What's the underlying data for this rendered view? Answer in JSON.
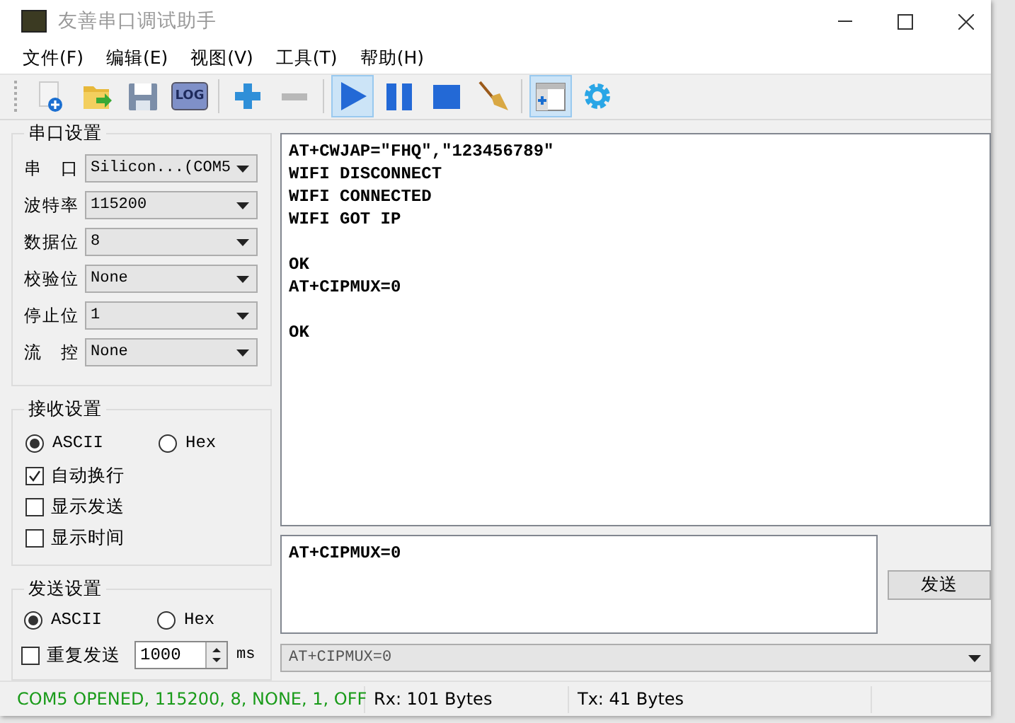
{
  "window": {
    "title": "友善串口调试助手"
  },
  "menu": [
    "文件(F)",
    "编辑(E)",
    "视图(V)",
    "工具(T)",
    "帮助(H)"
  ],
  "toolbar": [
    {
      "kind": "new",
      "selected": false
    },
    {
      "kind": "open",
      "selected": false
    },
    {
      "kind": "save",
      "selected": false
    },
    {
      "kind": "log",
      "label": "LOG",
      "selected": false
    },
    {
      "kind": "sep"
    },
    {
      "kind": "add",
      "selected": false
    },
    {
      "kind": "remove",
      "selected": false
    },
    {
      "kind": "sep"
    },
    {
      "kind": "play",
      "selected": true
    },
    {
      "kind": "pause",
      "selected": false
    },
    {
      "kind": "stop",
      "selected": false
    },
    {
      "kind": "clear",
      "selected": false
    },
    {
      "kind": "sep"
    },
    {
      "kind": "window",
      "selected": true
    },
    {
      "kind": "gear",
      "selected": false
    }
  ],
  "serial_settings": {
    "title": "串口设置",
    "fields": [
      {
        "label": "串口",
        "value": "Silicon...(COM5"
      },
      {
        "label": "波特率",
        "value": "115200"
      },
      {
        "label": "数据位",
        "value": "8"
      },
      {
        "label": "校验位",
        "value": "None"
      },
      {
        "label": "停止位",
        "value": "1"
      },
      {
        "label": "流控",
        "value": "None"
      }
    ]
  },
  "receive_settings": {
    "title": "接收设置",
    "modes": [
      {
        "label": "ASCII",
        "selected": true
      },
      {
        "label": "Hex",
        "selected": false
      }
    ],
    "options": [
      {
        "label": "自动换行",
        "checked": true
      },
      {
        "label": "显示发送",
        "checked": false
      },
      {
        "label": "显示时间",
        "checked": false
      }
    ]
  },
  "send_settings": {
    "title": "发送设置",
    "modes": [
      {
        "label": "ASCII",
        "selected": true
      },
      {
        "label": "Hex",
        "selected": false
      }
    ],
    "repeat": {
      "label": "重复发送",
      "checked": false,
      "interval": "1000",
      "unit": "ms"
    }
  },
  "receive_log": "AT+CWJAP=\"FHQ\",\"123456789\"\nWIFI DISCONNECT\nWIFI CONNECTED\nWIFI GOT IP\n\nOK\nAT+CIPMUX=0\n\nOK",
  "send_input": {
    "value": "AT+CIPMUX=0"
  },
  "send_button": "发送",
  "history": {
    "value": "AT+CIPMUX=0"
  },
  "status_bar": {
    "port_status": "COM5 OPENED, 115200, 8, NONE, 1, OFF",
    "rx": "Rx: 101 Bytes",
    "tx": "Tx: 41 Bytes"
  }
}
